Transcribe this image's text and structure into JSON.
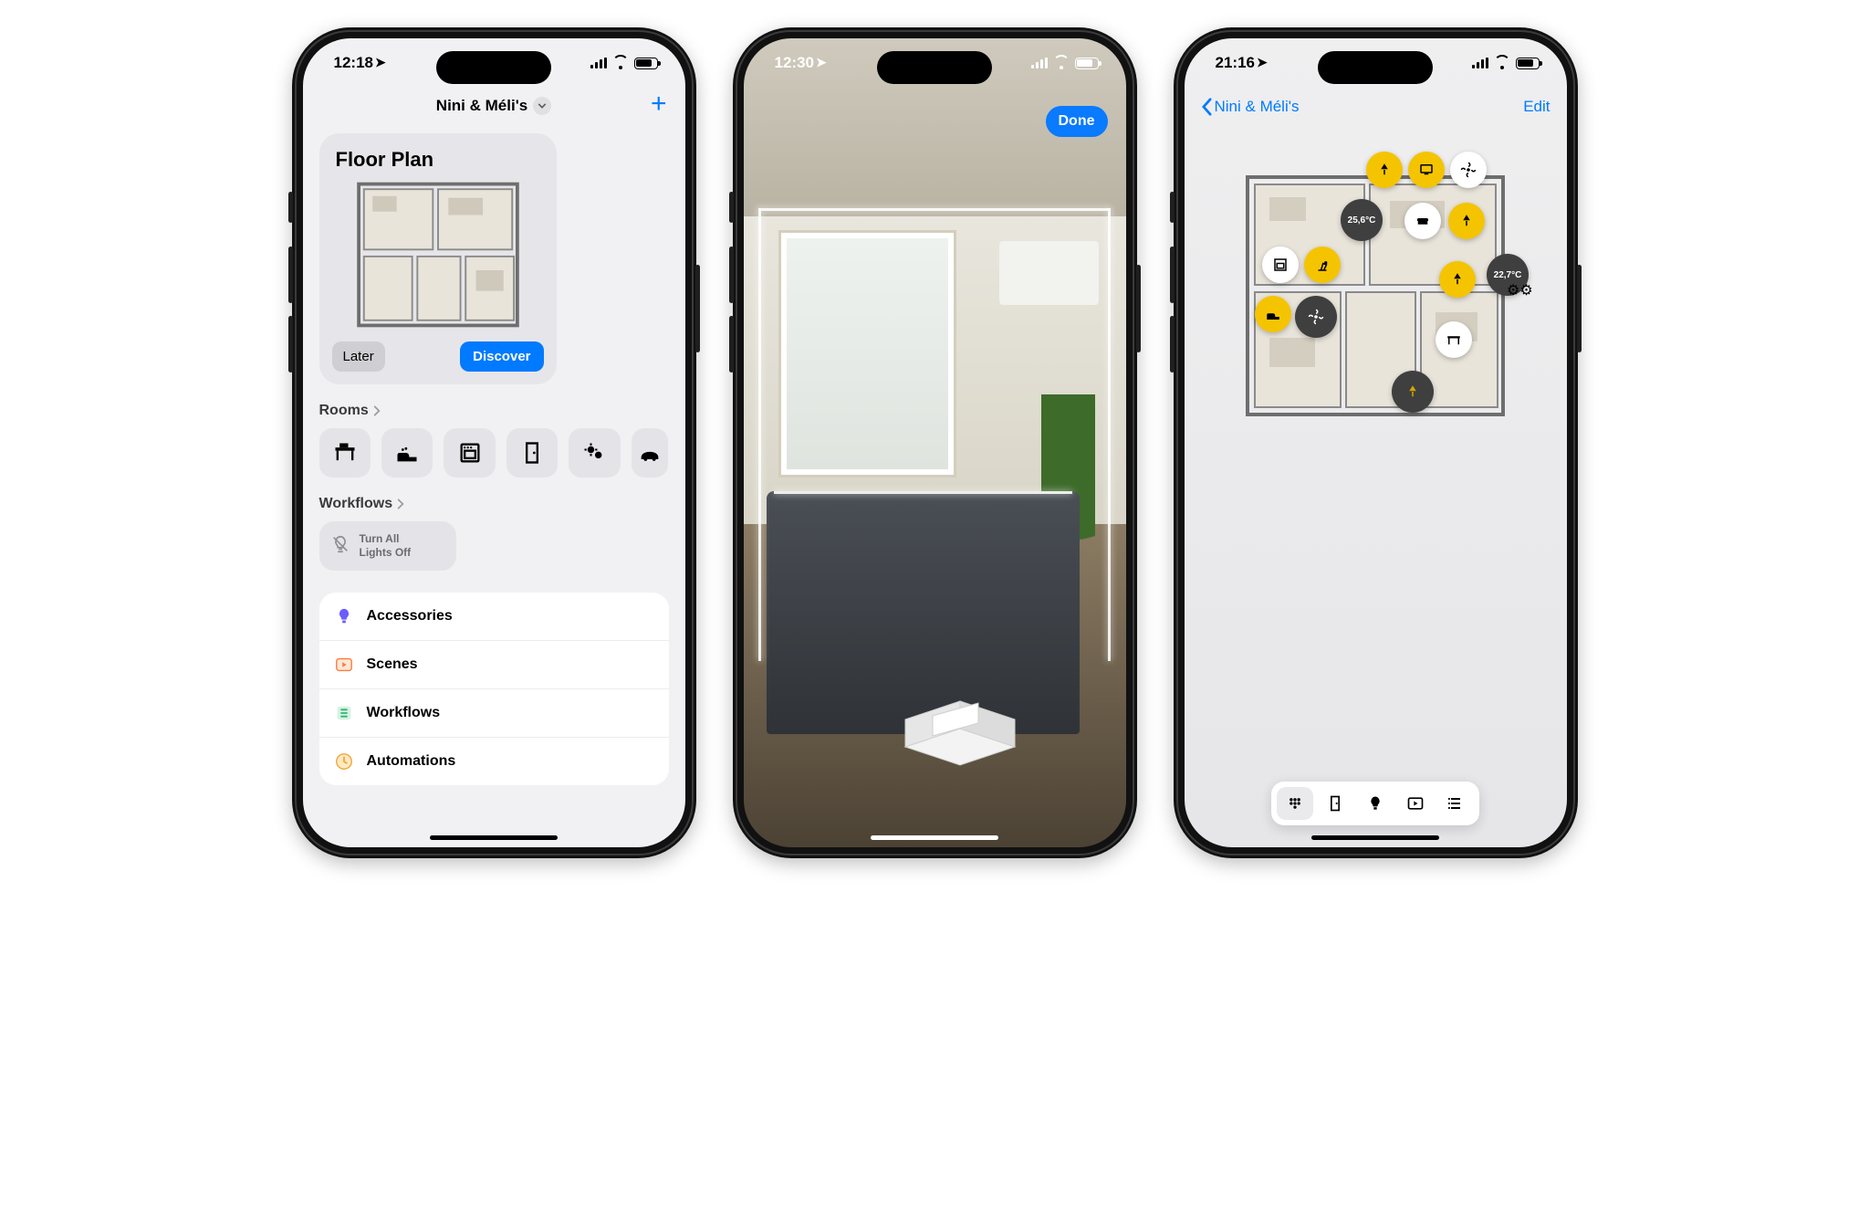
{
  "phone1": {
    "status_time": "12:18",
    "title": "Nini & Méli's",
    "card_title": "Floor Plan",
    "later_label": "Later",
    "discover_label": "Discover",
    "rooms_header": "Rooms",
    "workflows_header": "Workflows",
    "workflow1_line1": "Turn All",
    "workflow1_line2": "Lights Off",
    "list": {
      "accessories": "Accessories",
      "scenes": "Scenes",
      "workflows": "Workflows",
      "automations": "Automations"
    },
    "room_icons": [
      "desk",
      "bed",
      "oven",
      "door",
      "climate",
      "car"
    ]
  },
  "phone2": {
    "status_time": "12:30",
    "done_label": "Done"
  },
  "phone3": {
    "status_time": "21:16",
    "back_label": "Nini & Méli's",
    "edit_label": "Edit",
    "temp1": "25,6°C",
    "temp2": "22,7°C",
    "toolbar_icons": [
      "grid",
      "door",
      "bulb",
      "play",
      "list"
    ],
    "pin_icons": [
      "lamp",
      "tv",
      "fan",
      "sofa",
      "lamp",
      "oven",
      "desk-lamp",
      "lamp",
      "bed",
      "fan",
      "lamp",
      "desk",
      "lamp"
    ]
  },
  "colors": {
    "accent": "#007aff",
    "pin_yellow": "#f5c400",
    "pin_dark": "#3f3f3f"
  }
}
